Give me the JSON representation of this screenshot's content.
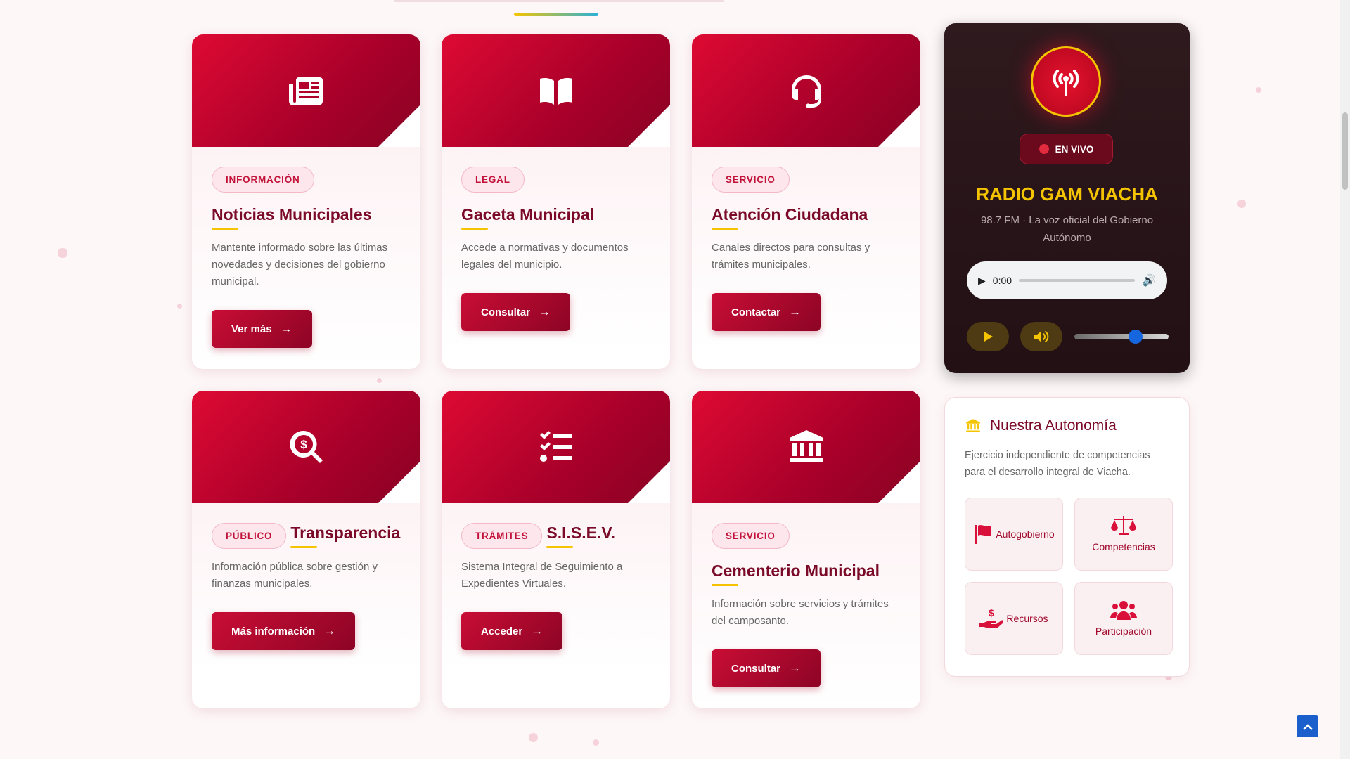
{
  "cards": [
    {
      "icon": "newspaper-icon",
      "badge": "INFORMACIÓN",
      "title": "Noticias Municipales",
      "desc": "Mantente informado sobre las últimas novedades y decisiones del gobierno municipal.",
      "button": "Ver más"
    },
    {
      "icon": "book-open-icon",
      "badge": "LEGAL",
      "title": "Gaceta Municipal",
      "desc": "Accede a normativas y documentos legales del municipio.",
      "button": "Consultar"
    },
    {
      "icon": "headset-icon",
      "badge": "SERVICIO",
      "title": "Atención Ciudadana",
      "desc": "Canales directos para consultas y trámites municipales.",
      "button": "Contactar"
    },
    {
      "icon": "search-dollar-icon",
      "badge": "PÚBLICO",
      "title": "Transparencia",
      "desc": "Información pública sobre gestión y finanzas municipales.",
      "button": "Más información"
    },
    {
      "icon": "tasks-icon",
      "badge": "TRÁMITES",
      "title": "S.I.S.E.V.",
      "desc": "Sistema Integral de Seguimiento a Expedientes Virtuales.",
      "button": "Acceder"
    },
    {
      "icon": "landmark-icon",
      "badge": "SERVICIO",
      "title": "Cementerio Municipal",
      "desc": "Información sobre servicios y trámites del camposanto.",
      "button": "Consultar"
    }
  ],
  "radio": {
    "live_label": "EN VIVO",
    "name": "RADIO GAM VIACHA",
    "subtitle": "98.7 FM · La voz oficial del Gobierno Autónomo",
    "audio_time": "0:00",
    "volume_level": 0.65,
    "accent_color": "#f5c400"
  },
  "autonomy": {
    "title": "Nuestra Autonomía",
    "desc": "Ejercicio independiente de competencias para el desarrollo integral de Viacha.",
    "items": [
      {
        "icon": "flag-icon",
        "label": "Autogobierno"
      },
      {
        "icon": "balance-scale-icon",
        "label": "Competencias"
      },
      {
        "icon": "hand-holding-dollar-icon",
        "label": "Recursos"
      },
      {
        "icon": "users-icon",
        "label": "Participación"
      }
    ]
  },
  "colors": {
    "primary": "#c90d35",
    "dark": "#7a0a27",
    "gold": "#f5c400"
  }
}
